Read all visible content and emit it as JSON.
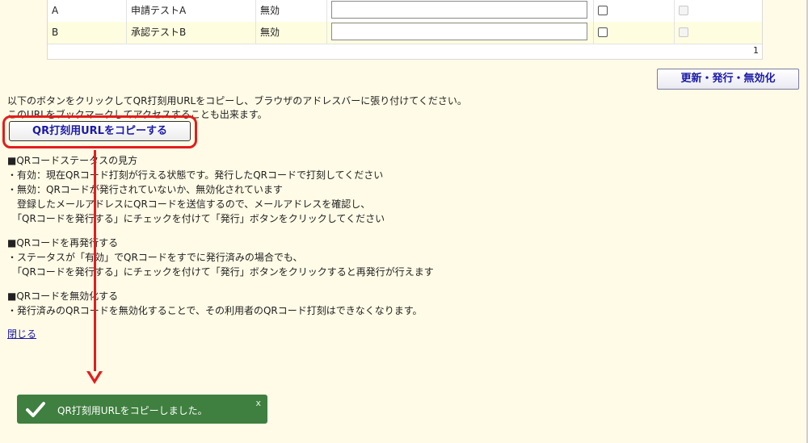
{
  "table": {
    "rows": [
      {
        "id": "A",
        "name": "申請テストA",
        "status": "無効"
      },
      {
        "id": "B",
        "name": "承認テストB",
        "status": "無効"
      }
    ],
    "page": "1"
  },
  "update_button": "更新・発行・無効化",
  "info": {
    "line1": "以下のボタンをクリックしてQR打刻用URLをコピーし、ブラウザのアドレスバーに張り付けてください。",
    "line2": "このURLをブックマークしてアクセスすることも出来ます。"
  },
  "copy_button": "QR打刻用URLをコピーする",
  "sections": {
    "status": {
      "title": "■QRコードステータスの見方",
      "lines": [
        "・有効：現在QRコード打刻が行える状態です。発行したQRコードで打刻してください",
        "・無効：QRコードが発行されていないか、無効化されています",
        "　登録したメールアドレスにQRコードを送信するので、メールアドレスを確認し、",
        "　「QRコードを発行する」にチェックを付けて「発行」ボタンをクリックしてください"
      ]
    },
    "reissue": {
      "title": "■QRコードを再発行する",
      "lines": [
        "・ステータスが「有効」でQRコードをすでに発行済みの場合でも、",
        "　「QRコードを発行する」にチェックを付けて「発行」ボタンをクリックすると再発行が行えます"
      ]
    },
    "invalidate": {
      "title": "■QRコードを無効化する",
      "lines": [
        "・発行済みのQRコードを無効化することで、その利用者のQRコード打刻はできなくなります。"
      ]
    }
  },
  "close_link": "閉じる",
  "toast": {
    "message": "QR打刻用URLをコピーしました。",
    "close": "x"
  },
  "colors": {
    "background": "#fffbe6",
    "annotation_red": "#e21d1d",
    "toast_green": "#3f7f3f",
    "button_text": "#1a1aa8"
  }
}
